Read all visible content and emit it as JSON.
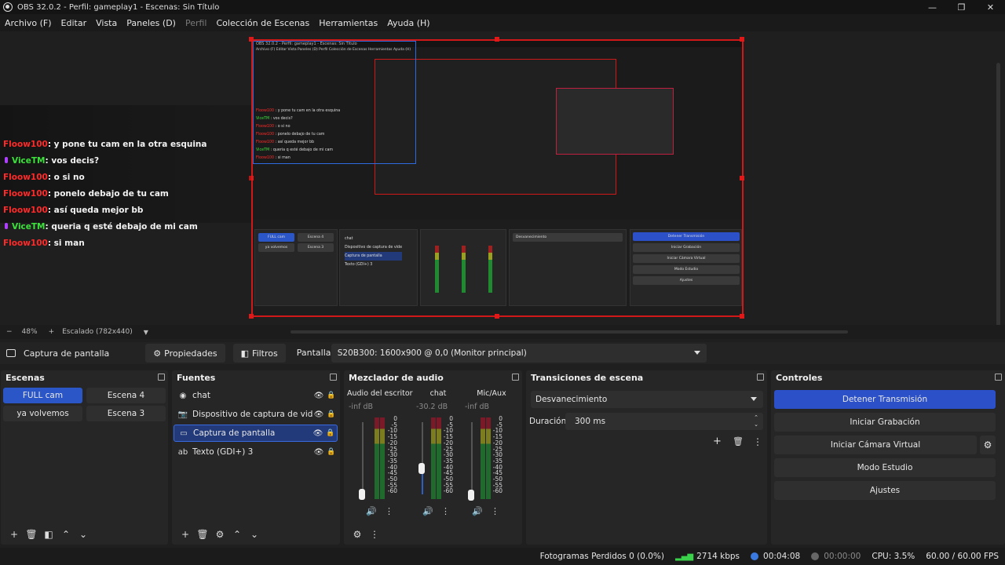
{
  "window": {
    "title": "OBS 32.0.2 - Perfil: gameplay1 - Escenas: Sin Título",
    "minimize": "—",
    "maximize": "❐",
    "close": "✕"
  },
  "menu": {
    "items": [
      {
        "label": "Archivo (F)",
        "enabled": true
      },
      {
        "label": "Editar",
        "enabled": true
      },
      {
        "label": "Vista",
        "enabled": true
      },
      {
        "label": "Paneles (D)",
        "enabled": true
      },
      {
        "label": "Perfil",
        "enabled": false
      },
      {
        "label": "Colección de Escenas",
        "enabled": true
      },
      {
        "label": "Herramientas",
        "enabled": true
      },
      {
        "label": "Ayuda (H)",
        "enabled": true
      }
    ]
  },
  "chat": {
    "lines": [
      {
        "user": "Floow100",
        "color": "red",
        "badge": false,
        "text": ": y pone tu cam en la otra esquina"
      },
      {
        "user": "ViceTM",
        "color": "green",
        "badge": true,
        "text": ": vos decis?"
      },
      {
        "user": "Floow100",
        "color": "red",
        "badge": false,
        "text": ": o si no"
      },
      {
        "user": "Floow100",
        "color": "red",
        "badge": false,
        "text": ": ponelo debajo de tu cam"
      },
      {
        "user": "Floow100",
        "color": "red",
        "badge": false,
        "text": ": así queda mejor bb"
      },
      {
        "user": "ViceTM",
        "color": "green",
        "badge": true,
        "text": ": queria q esté debajo de mi cam"
      },
      {
        "user": "Floow100",
        "color": "red",
        "badge": false,
        "text": ": si man"
      }
    ]
  },
  "preview": {
    "zoom": "48%",
    "scaling": "Escalado (782x440)",
    "minus": "−",
    "plus": "+",
    "mini_title": "OBS 32.0.2 - Perfil: gameplay1 - Escenas: Sin Título",
    "mini_menu": "Archivo (F)   Editar   Vista   Paneles (D)   Perfil   Colección de Escenas   Herramientas   Ayuda (H)"
  },
  "source_toolbar": {
    "source_name": "Captura de pantalla",
    "properties": "Propiedades",
    "filters": "Filtros",
    "display_label": "Pantalla",
    "display_value": "S20B300: 1600x900 @ 0,0 (Monitor principal)"
  },
  "scenes": {
    "title": "Escenas",
    "items": [
      "FULL cam",
      "Escena 4",
      "ya volvemos",
      "Escena 3"
    ],
    "active": "FULL cam"
  },
  "sources": {
    "title": "Fuentes",
    "items": [
      {
        "label": "chat",
        "icon": "browser-icon"
      },
      {
        "label": "Dispositivo de captura de vide",
        "icon": "camera-icon"
      },
      {
        "label": "Captura de pantalla",
        "icon": "monitor-icon"
      },
      {
        "label": "Texto (GDI+) 3",
        "icon": "text-icon"
      }
    ],
    "active": "Captura de pantalla"
  },
  "mixer": {
    "title": "Mezclador de audio",
    "channels": [
      {
        "name": "Audio del escritorio",
        "db": "-inf dB",
        "volume": 0.0
      },
      {
        "name": "chat",
        "db": "-30.2 dB",
        "volume": 0.35
      },
      {
        "name": "Mic/Aux",
        "db": "-inf dB",
        "volume": 0.0
      }
    ],
    "scale": [
      "0",
      "-5",
      "-10",
      "-15",
      "-20",
      "-25",
      "-30",
      "-35",
      "-40",
      "-45",
      "-50",
      "-55",
      "-60"
    ]
  },
  "transitions": {
    "title": "Transiciones de escena",
    "selected": "Desvanecimiento",
    "duration_label": "Duración",
    "duration_value": "300 ms"
  },
  "controls": {
    "title": "Controles",
    "stop_stream": "Detener Transmisión",
    "start_recording": "Iniciar Grabación",
    "start_virtual_cam": "Iniciar Cámara Virtual",
    "studio_mode": "Modo Estudio",
    "settings": "Ajustes"
  },
  "status": {
    "dropped_frames": "Fotogramas Perdidos 0 (0.0%)",
    "bitrate": "2714 kbps",
    "stream_time": "00:04:08",
    "rec_time": "00:00:00",
    "cpu": "CPU: 3.5%",
    "fps": "60.00 / 60.00 FPS"
  },
  "colors": {
    "accent": "#2b56c8",
    "preview_border": "#d01818",
    "chat_red": "#ff2a2a",
    "chat_green": "#3ae23a"
  }
}
